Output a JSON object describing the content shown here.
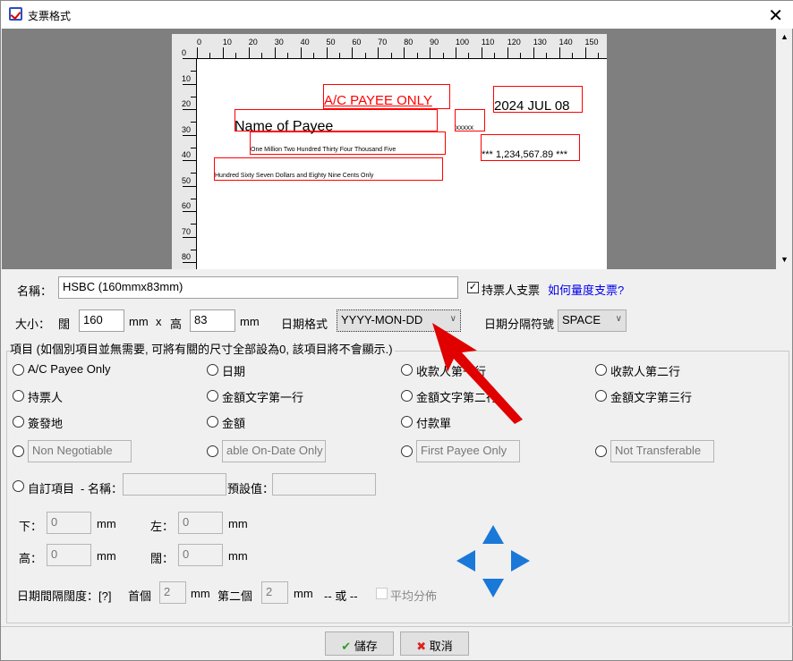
{
  "window": {
    "title": "支票格式",
    "close_icon": "close-icon"
  },
  "preview": {
    "x_ruler_labels": [
      "0",
      "10",
      "20",
      "30",
      "40",
      "50",
      "60",
      "70",
      "80",
      "90",
      "100",
      "110",
      "120",
      "130",
      "140",
      "150"
    ],
    "y_ruler_labels": [
      "0",
      "10",
      "20",
      "30",
      "40",
      "50",
      "60",
      "70",
      "80"
    ],
    "fields": {
      "ac_payee": "A/C PAYEE ONLY",
      "date": "2024 JUL 08",
      "payee": "Name of Payee",
      "bearer": "xxxxx",
      "words1": "One Million Two Hundred Thirty Four Thousand Five",
      "words2": "Hundred Sixty Seven Dollars and Eighty Nine Cents Only",
      "amount": "*** 1,234,567.89 ***"
    },
    "box_color": "#ff0000"
  },
  "form": {
    "name_label": "名稱：",
    "name_value": "HSBC (160mmx83mm)",
    "bearer_check_label": "持票人支票",
    "bearer_checked": true,
    "help_link": "如何量度支票?",
    "size_label": "大小：",
    "width_label": "闊",
    "width_value": "160",
    "mm": "mm",
    "x": "x",
    "height_label": "高",
    "height_value": "83",
    "date_format_label": "日期格式",
    "date_format_value": "YYYY-MON-DD",
    "date_sep_label": "日期分隔符號",
    "date_sep_value": "SPACE"
  },
  "items": {
    "legend": "項目 (如個別項目並無需要, 可將有關的尺寸全部設為0, 該項目將不會顯示.)",
    "radios": [
      "A/C Payee Only",
      "日期",
      "收款人第一行",
      "收款人第二行",
      "持票人",
      "金額文字第一行",
      "金額文字第二行",
      "金額文字第三行",
      "簽發地",
      "金額",
      "付款單"
    ],
    "text_radios": [
      "Non Negotiable",
      "able On-Date Only",
      "First Payee Only",
      "Not Transferable"
    ],
    "custom_label": "自訂項目",
    "custom_name_label": "- 名稱：",
    "custom_default_label": "預設值：",
    "bottom_label": "下：",
    "left_label": "左：",
    "h_label": "高：",
    "w_label": "闊：",
    "bottom_value": "0",
    "left_value": "0",
    "h_value": "0",
    "w_value": "0",
    "mm": "mm",
    "date_spacing_label": "日期間隔闊度：[?]",
    "first_label": "首個",
    "first_value": "2",
    "second_label": "第二個",
    "second_value": "2",
    "or_label": "-- 或 --",
    "even_label": "平均分佈"
  },
  "buttons": {
    "save": "儲存",
    "cancel": "取消"
  },
  "colors": {
    "accent_arrow": "#e00000",
    "link": "#0000ee",
    "nav_arrows": "#1a78d8"
  }
}
